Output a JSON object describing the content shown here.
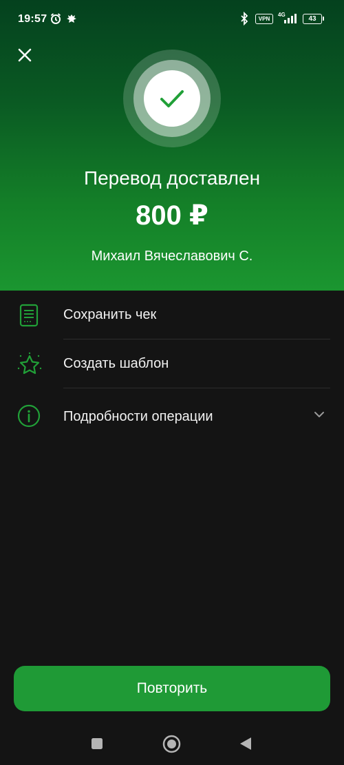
{
  "status_bar": {
    "time": "19:57",
    "vpn": "VPN",
    "network": "4G",
    "battery": "43"
  },
  "icons": {
    "close": "close-icon",
    "success": "check-icon",
    "receipt": "receipt-icon",
    "template": "star-icon",
    "details": "info-icon",
    "expand": "chevron-down-icon"
  },
  "hero": {
    "title": "Перевод доставлен",
    "amount": "800 ₽",
    "recipient": "Михаил Вячеславович С."
  },
  "actions": [
    {
      "label": "Сохранить чек"
    },
    {
      "label": "Создать шаблон"
    },
    {
      "label": "Подробности операции"
    }
  ],
  "repeat_button": {
    "label": "Повторить"
  },
  "colors": {
    "accent": "#21a038",
    "button": "#1f9a36",
    "background": "#141414"
  }
}
